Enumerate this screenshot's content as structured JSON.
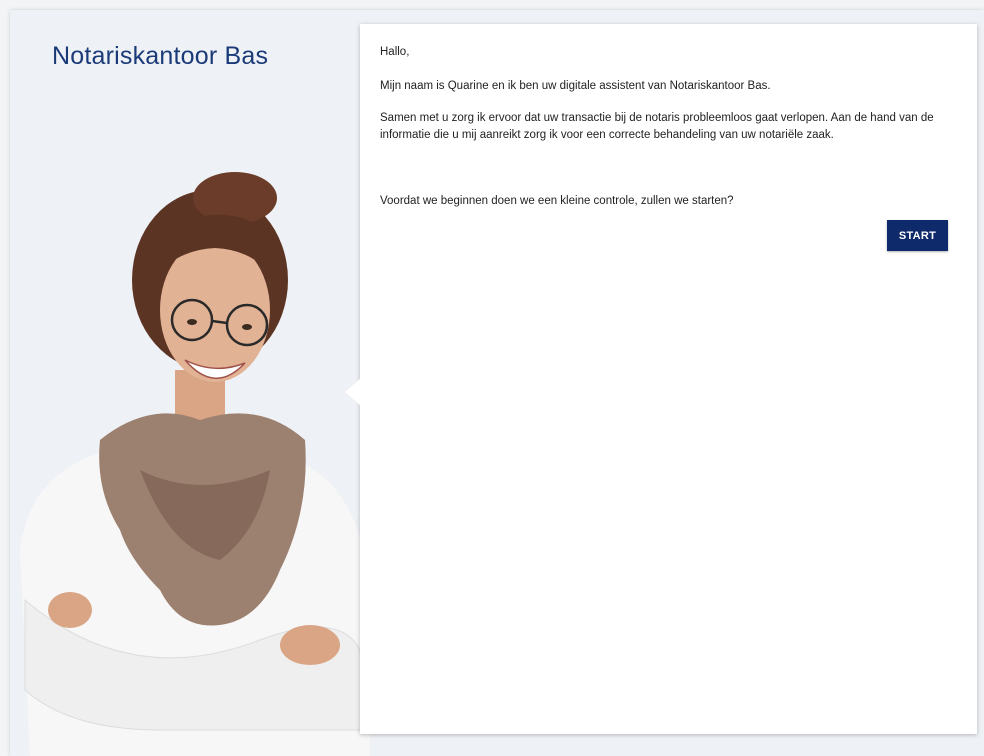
{
  "brand": {
    "title": "Notariskantoor Bas"
  },
  "chat": {
    "greeting": "Hallo,",
    "intro": "Mijn naam is Quarine en ik ben uw digitale assistent van Notariskantoor Bas.",
    "explanation": "Samen met u zorg ik ervoor dat uw transactie bij de notaris probleemloos gaat verlopen. Aan de hand van de informatie die u mij aanreikt zorg ik voor een correcte behandeling van uw notariële zaak.",
    "question": "Voordat we beginnen doen we een kleine controle, zullen we starten?",
    "start_label": "START"
  },
  "colors": {
    "brand": "#1a3a78",
    "button": "#0f2a6b",
    "background": "#eef1f5",
    "panel": "#ffffff"
  },
  "icons": {
    "assistant": "assistant-portrait"
  }
}
